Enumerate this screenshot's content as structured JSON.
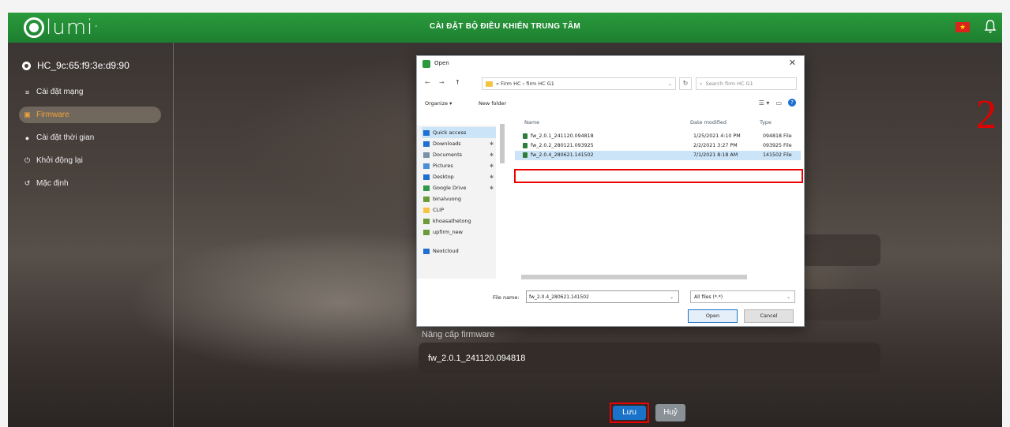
{
  "header": {
    "logo_text": "lumi",
    "title": "CÀI ĐẶT BỘ ĐIỀU KHIỂN TRUNG TÂM",
    "flag_icon": "vietnam-flag-icon",
    "bell_icon": "bell-icon"
  },
  "sidebar": {
    "device_id": "HC_9c:65:f9:3e:d9:90",
    "items": [
      {
        "label": "Cài đặt mạng",
        "icon": "network-icon",
        "glyph": "≡"
      },
      {
        "label": "Firmware",
        "icon": "firmware-icon",
        "glyph": "▣"
      },
      {
        "label": "Cài đặt thời gian",
        "icon": "clock-icon",
        "glyph": "●"
      },
      {
        "label": "Khởi động lại",
        "icon": "power-icon",
        "glyph": "⏻"
      },
      {
        "label": "Mặc định",
        "icon": "reset-icon",
        "glyph": "↺"
      }
    ],
    "active_index": 1
  },
  "form": {
    "upgrade_label": "Nâng cấp firmware",
    "upgrade_value": "fw_2.0.1_241120.094818",
    "save_label": "Lưu",
    "cancel_label": "Huỷ"
  },
  "annotation": {
    "step_number": "2",
    "color": "#e00000"
  },
  "dialog": {
    "title": "Open",
    "close_glyph": "✕",
    "nav": {
      "back": "←",
      "forward": "→",
      "up": "↑"
    },
    "address_path": "« Firm HC  ›  firm HC G1",
    "search_placeholder": "Search firm HC G1",
    "toolbar": {
      "organize": "Organize ▾",
      "new_folder": "New folder"
    },
    "quick_access": [
      {
        "label": "Quick access",
        "icon": "star-icon",
        "color": "#1f6fd1",
        "pinned": false
      },
      {
        "label": "Downloads",
        "icon": "download-icon",
        "color": "#1f6fd1",
        "pinned": true
      },
      {
        "label": "Documents",
        "icon": "documents-icon",
        "color": "#7a8fa8",
        "pinned": true
      },
      {
        "label": "Pictures",
        "icon": "pictures-icon",
        "color": "#4a8fd6",
        "pinned": true
      },
      {
        "label": "Desktop",
        "icon": "desktop-icon",
        "color": "#1f6fd1",
        "pinned": true
      },
      {
        "label": "Google Drive",
        "icon": "google-drive-icon",
        "color": "#2f9a47",
        "pinned": true
      },
      {
        "label": "binalvuong",
        "icon": "folder-icon",
        "color": "#6a9a3a",
        "pinned": false
      },
      {
        "label": "CLIP",
        "icon": "folder-icon",
        "color": "#f5c542",
        "pinned": false
      },
      {
        "label": "khoasathetong",
        "icon": "folder-icon",
        "color": "#6a9a3a",
        "pinned": false
      },
      {
        "label": "upfirm_new",
        "icon": "folder-icon",
        "color": "#6a9a3a",
        "pinned": false
      },
      {
        "label": "Nextcloud",
        "icon": "cloud-icon",
        "color": "#1f6fd1",
        "pinned": false
      }
    ],
    "columns": {
      "name": "Name",
      "date": "Date modified",
      "type": "Type"
    },
    "files": [
      {
        "name": "fw_2.0.1_241120.094818",
        "date": "1/25/2021 4:10 PM",
        "type": "094818 File"
      },
      {
        "name": "fw_2.0.2_280121.093925",
        "date": "2/2/2021 3:27 PM",
        "type": "093925 File"
      },
      {
        "name": "fw_2.0.4_280621.141502",
        "date": "7/1/2021 8:18 AM",
        "type": "141502 File"
      }
    ],
    "selected_file_index": 2,
    "file_name_label": "File name:",
    "file_name_value": "fw_2.0.4_280621.141502",
    "file_type_value": "All files (*.*)",
    "open_label": "Open",
    "cancel_label": "Cancel"
  }
}
